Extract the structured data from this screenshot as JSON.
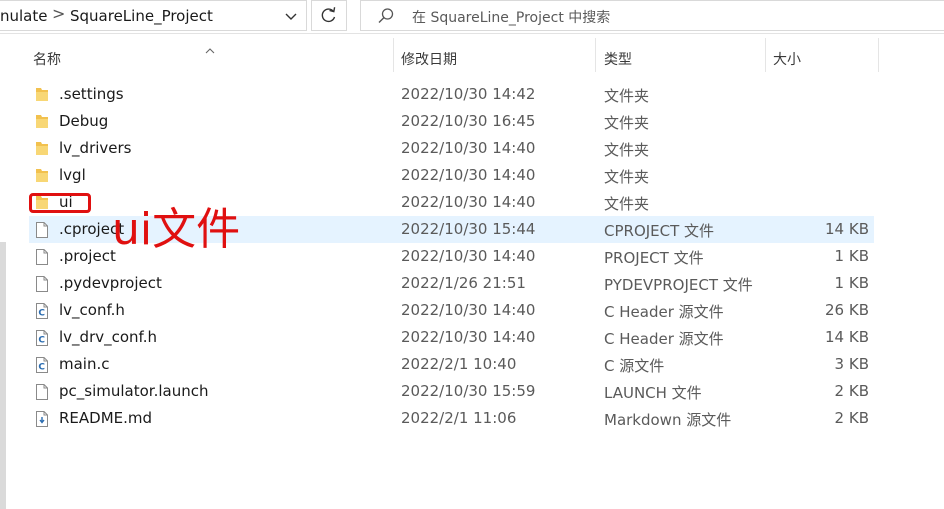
{
  "address_bar": {
    "prev_crumb": "nulate",
    "separator": ">",
    "current_crumb": "SquareLine_Project"
  },
  "search": {
    "placeholder": "在 SquareLine_Project 中搜索"
  },
  "columns": {
    "name": "名称",
    "date": "修改日期",
    "type": "类型",
    "size": "大小"
  },
  "files": [
    {
      "name": ".settings",
      "date": "2022/10/30 14:42",
      "type": "文件夹",
      "size": "",
      "icon": "folder-icon"
    },
    {
      "name": "Debug",
      "date": "2022/10/30 16:45",
      "type": "文件夹",
      "size": "",
      "icon": "folder-icon"
    },
    {
      "name": "lv_drivers",
      "date": "2022/10/30 14:40",
      "type": "文件夹",
      "size": "",
      "icon": "folder-icon"
    },
    {
      "name": "lvgl",
      "date": "2022/10/30 14:40",
      "type": "文件夹",
      "size": "",
      "icon": "folder-icon"
    },
    {
      "name": "ui",
      "date": "2022/10/30 14:40",
      "type": "文件夹",
      "size": "",
      "icon": "folder-icon"
    },
    {
      "name": ".cproject",
      "date": "2022/10/30 15:44",
      "type": "CPROJECT 文件",
      "size": "14 KB",
      "icon": "file-icon"
    },
    {
      "name": ".project",
      "date": "2022/10/30 14:40",
      "type": "PROJECT 文件",
      "size": "1 KB",
      "icon": "file-icon"
    },
    {
      "name": ".pydevproject",
      "date": "2022/1/26 21:51",
      "type": "PYDEVPROJECT 文件",
      "size": "1 KB",
      "icon": "file-icon"
    },
    {
      "name": "lv_conf.h",
      "date": "2022/10/30 14:40",
      "type": "C Header 源文件",
      "size": "26 KB",
      "icon": "c-file-icon"
    },
    {
      "name": "lv_drv_conf.h",
      "date": "2022/10/30 14:40",
      "type": "C Header 源文件",
      "size": "14 KB",
      "icon": "c-file-icon"
    },
    {
      "name": "main.c",
      "date": "2022/2/1 10:40",
      "type": "C 源文件",
      "size": "3 KB",
      "icon": "c-file-icon"
    },
    {
      "name": "pc_simulator.launch",
      "date": "2022/10/30 15:59",
      "type": "LAUNCH 文件",
      "size": "2 KB",
      "icon": "file-icon"
    },
    {
      "name": "README.md",
      "date": "2022/2/1 11:06",
      "type": "Markdown 源文件",
      "size": "2 KB",
      "icon": "markdown-file-icon"
    }
  ],
  "selected_row": 5,
  "annotation": {
    "text": "ui文件",
    "color": "#e01010"
  },
  "colors": {
    "selection": "#e5f3ff",
    "folder": "#f2c14e",
    "c_icon": "#2b6cb0"
  }
}
